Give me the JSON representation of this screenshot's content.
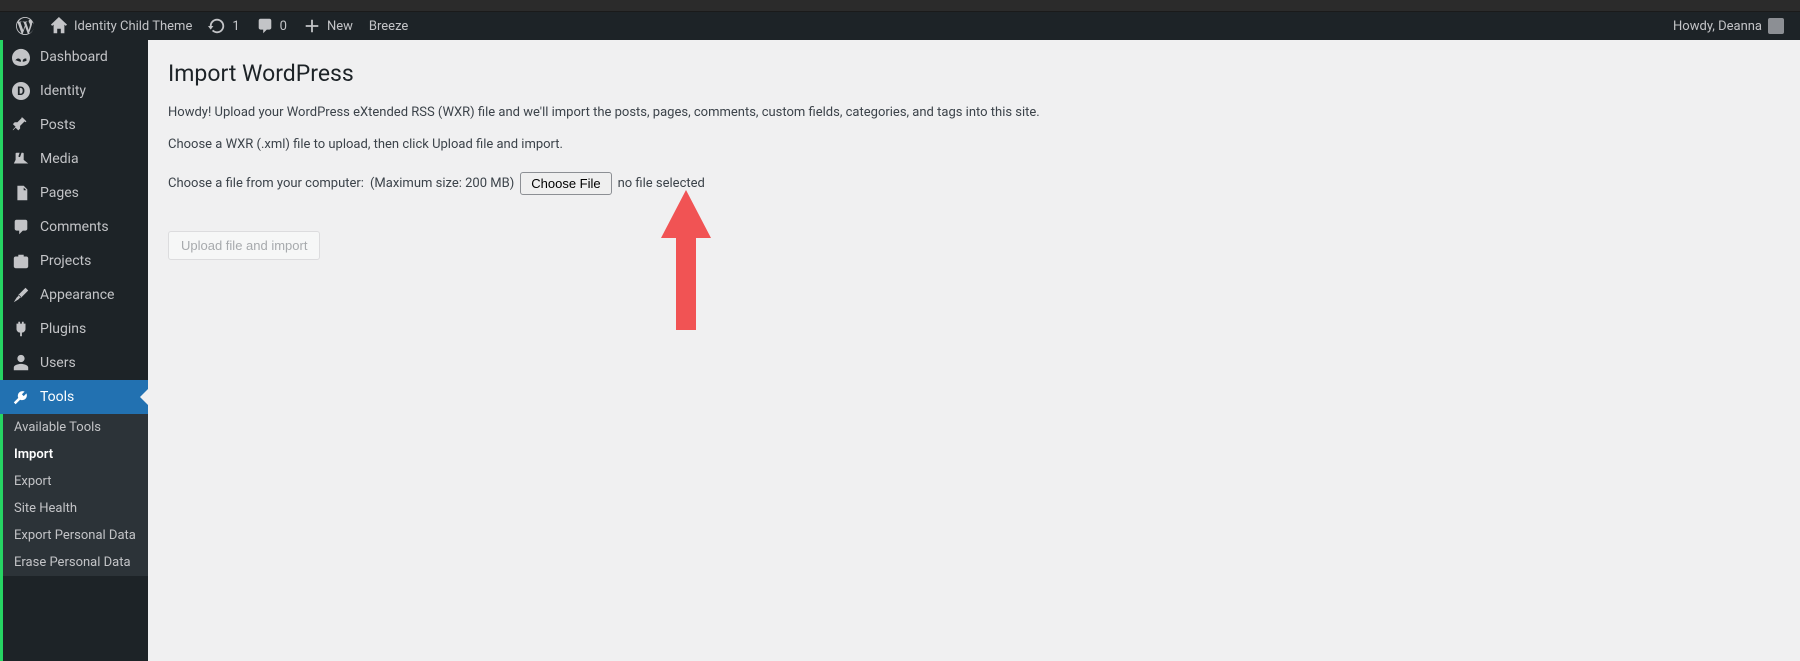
{
  "adminbar": {
    "site_name": "Identity Child Theme",
    "updates_count": "1",
    "comments_count": "0",
    "new_label": "New",
    "breeze_label": "Breeze",
    "howdy": "Howdy, Deanna"
  },
  "sidebar": {
    "items": [
      {
        "label": "Dashboard"
      },
      {
        "label": "Identity"
      },
      {
        "label": "Posts"
      },
      {
        "label": "Media"
      },
      {
        "label": "Pages"
      },
      {
        "label": "Comments"
      },
      {
        "label": "Projects"
      },
      {
        "label": "Appearance"
      },
      {
        "label": "Plugins"
      },
      {
        "label": "Users"
      },
      {
        "label": "Tools"
      }
    ],
    "submenu": [
      {
        "label": "Available Tools"
      },
      {
        "label": "Import"
      },
      {
        "label": "Export"
      },
      {
        "label": "Site Health"
      },
      {
        "label": "Export Personal Data"
      },
      {
        "label": "Erase Personal Data"
      }
    ]
  },
  "page": {
    "title": "Import WordPress",
    "intro": "Howdy! Upload your WordPress eXtended RSS (WXR) file and we'll import the posts, pages, comments, custom fields, categories, and tags into this site.",
    "instruction": "Choose a WXR (.xml) file to upload, then click Upload file and import.",
    "choose_label": "Choose a file from your computer:",
    "max_size": "(Maximum size: 200 MB)",
    "choose_file_btn": "Choose File",
    "no_file": "no file selected",
    "submit_btn": "Upload file and import"
  }
}
